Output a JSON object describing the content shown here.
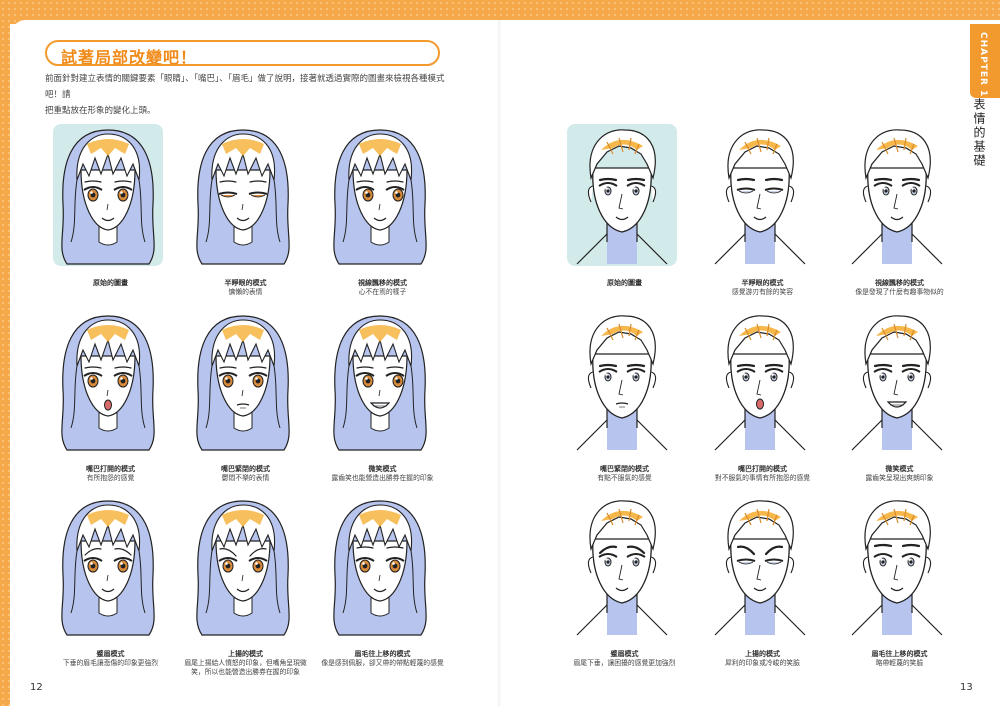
{
  "chapter_tab": "CHAPTER 1",
  "chapter_name": "表情的基礎",
  "section_title": "試著局部改變吧！",
  "intro_lines": [
    "前面針對建立表情的關鍵要素「眼睛」、「嘴巴」、「眉毛」做了說明，接著就透過實際的圖畫來檢視各種模式吧！請",
    "把重點放在形象的變化上頭。"
  ],
  "colors": {
    "accent": "#f39a2f",
    "hair": "#f7b84b",
    "shadow": "#b7c5ee",
    "highlight_bg": "#d3eaea"
  },
  "left_page": {
    "page_number": "12",
    "cells": [
      {
        "title": "原始的圖畫",
        "desc": [],
        "eyes": "open",
        "mouth": "smile",
        "brows": "normal",
        "original": true
      },
      {
        "title": "半睜眼的模式",
        "desc": [
          "慵懶的表情"
        ],
        "eyes": "half",
        "mouth": "smile",
        "brows": "normal"
      },
      {
        "title": "視線飄移的模式",
        "desc": [
          "心不在焉的樣子"
        ],
        "eyes": "side",
        "mouth": "smile",
        "brows": "normal"
      },
      {
        "title": "嘴巴打開的模式",
        "desc": [
          "有所抱怨的感覺"
        ],
        "eyes": "open",
        "mouth": "o",
        "brows": "normal"
      },
      {
        "title": "嘴巴緊閉的模式",
        "desc": [
          "鬱悶不樂的表情"
        ],
        "eyes": "open",
        "mouth": "closed",
        "brows": "normal"
      },
      {
        "title": "微笑模式",
        "desc": [
          "露齒笑也能營造出勝券在握的印象"
        ],
        "eyes": "side",
        "mouth": "grin",
        "brows": "normal"
      },
      {
        "title": "蹙眉模式",
        "desc": [
          "下垂的眉毛讓悲傷的印象更強烈"
        ],
        "eyes": "open",
        "mouth": "smile",
        "brows": "sad"
      },
      {
        "title": "上揚的模式",
        "desc": [
          "眉尾上揚給人憤怒的印象，但嘴角呈現微",
          "笑，所以也能營造出勝券在握的印象"
        ],
        "eyes": "open",
        "mouth": "smile",
        "brows": "up"
      },
      {
        "title": "眉毛往上移的模式",
        "desc": [
          "像是感到佩服，卻又帶的帶點輕蔑的感覺"
        ],
        "eyes": "open",
        "mouth": "smile",
        "brows": "raised"
      }
    ]
  },
  "right_page": {
    "page_number": "13",
    "cells": [
      {
        "title": "原始的圖畫",
        "desc": [],
        "eyes": "open",
        "mouth": "smile",
        "brows": "normal",
        "original": true
      },
      {
        "title": "半睜眼的模式",
        "desc": [
          "感覺游刃有餘的笑容"
        ],
        "eyes": "half",
        "mouth": "smile",
        "brows": "normal"
      },
      {
        "title": "視線飄移的模式",
        "desc": [
          "像是發現了什麼有趣事物似的"
        ],
        "eyes": "side",
        "mouth": "smile",
        "brows": "normal"
      },
      {
        "title": "嘴巴緊閉的模式",
        "desc": [
          "有點不服氣的感覺"
        ],
        "eyes": "open",
        "mouth": "closed",
        "brows": "normal"
      },
      {
        "title": "嘴巴打開的模式",
        "desc": [
          "對不服氣的事情有所抱怨的感覺"
        ],
        "eyes": "open",
        "mouth": "o",
        "brows": "normal"
      },
      {
        "title": "微笑模式",
        "desc": [
          "露齒笑呈現出爽朗印象"
        ],
        "eyes": "open",
        "mouth": "grin",
        "brows": "normal"
      },
      {
        "title": "蹙眉模式",
        "desc": [
          "眉尾下垂，讓困擾的感覺更加強烈"
        ],
        "eyes": "open",
        "mouth": "smile",
        "brows": "sad"
      },
      {
        "title": "上揚的模式",
        "desc": [
          "犀利的印象或冷峻的笑臉"
        ],
        "eyes": "half",
        "mouth": "smile",
        "brows": "up"
      },
      {
        "title": "眉毛往上移的模式",
        "desc": [
          "略帶輕蔑的笑臉"
        ],
        "eyes": "open",
        "mouth": "smile",
        "brows": "raised"
      }
    ]
  }
}
